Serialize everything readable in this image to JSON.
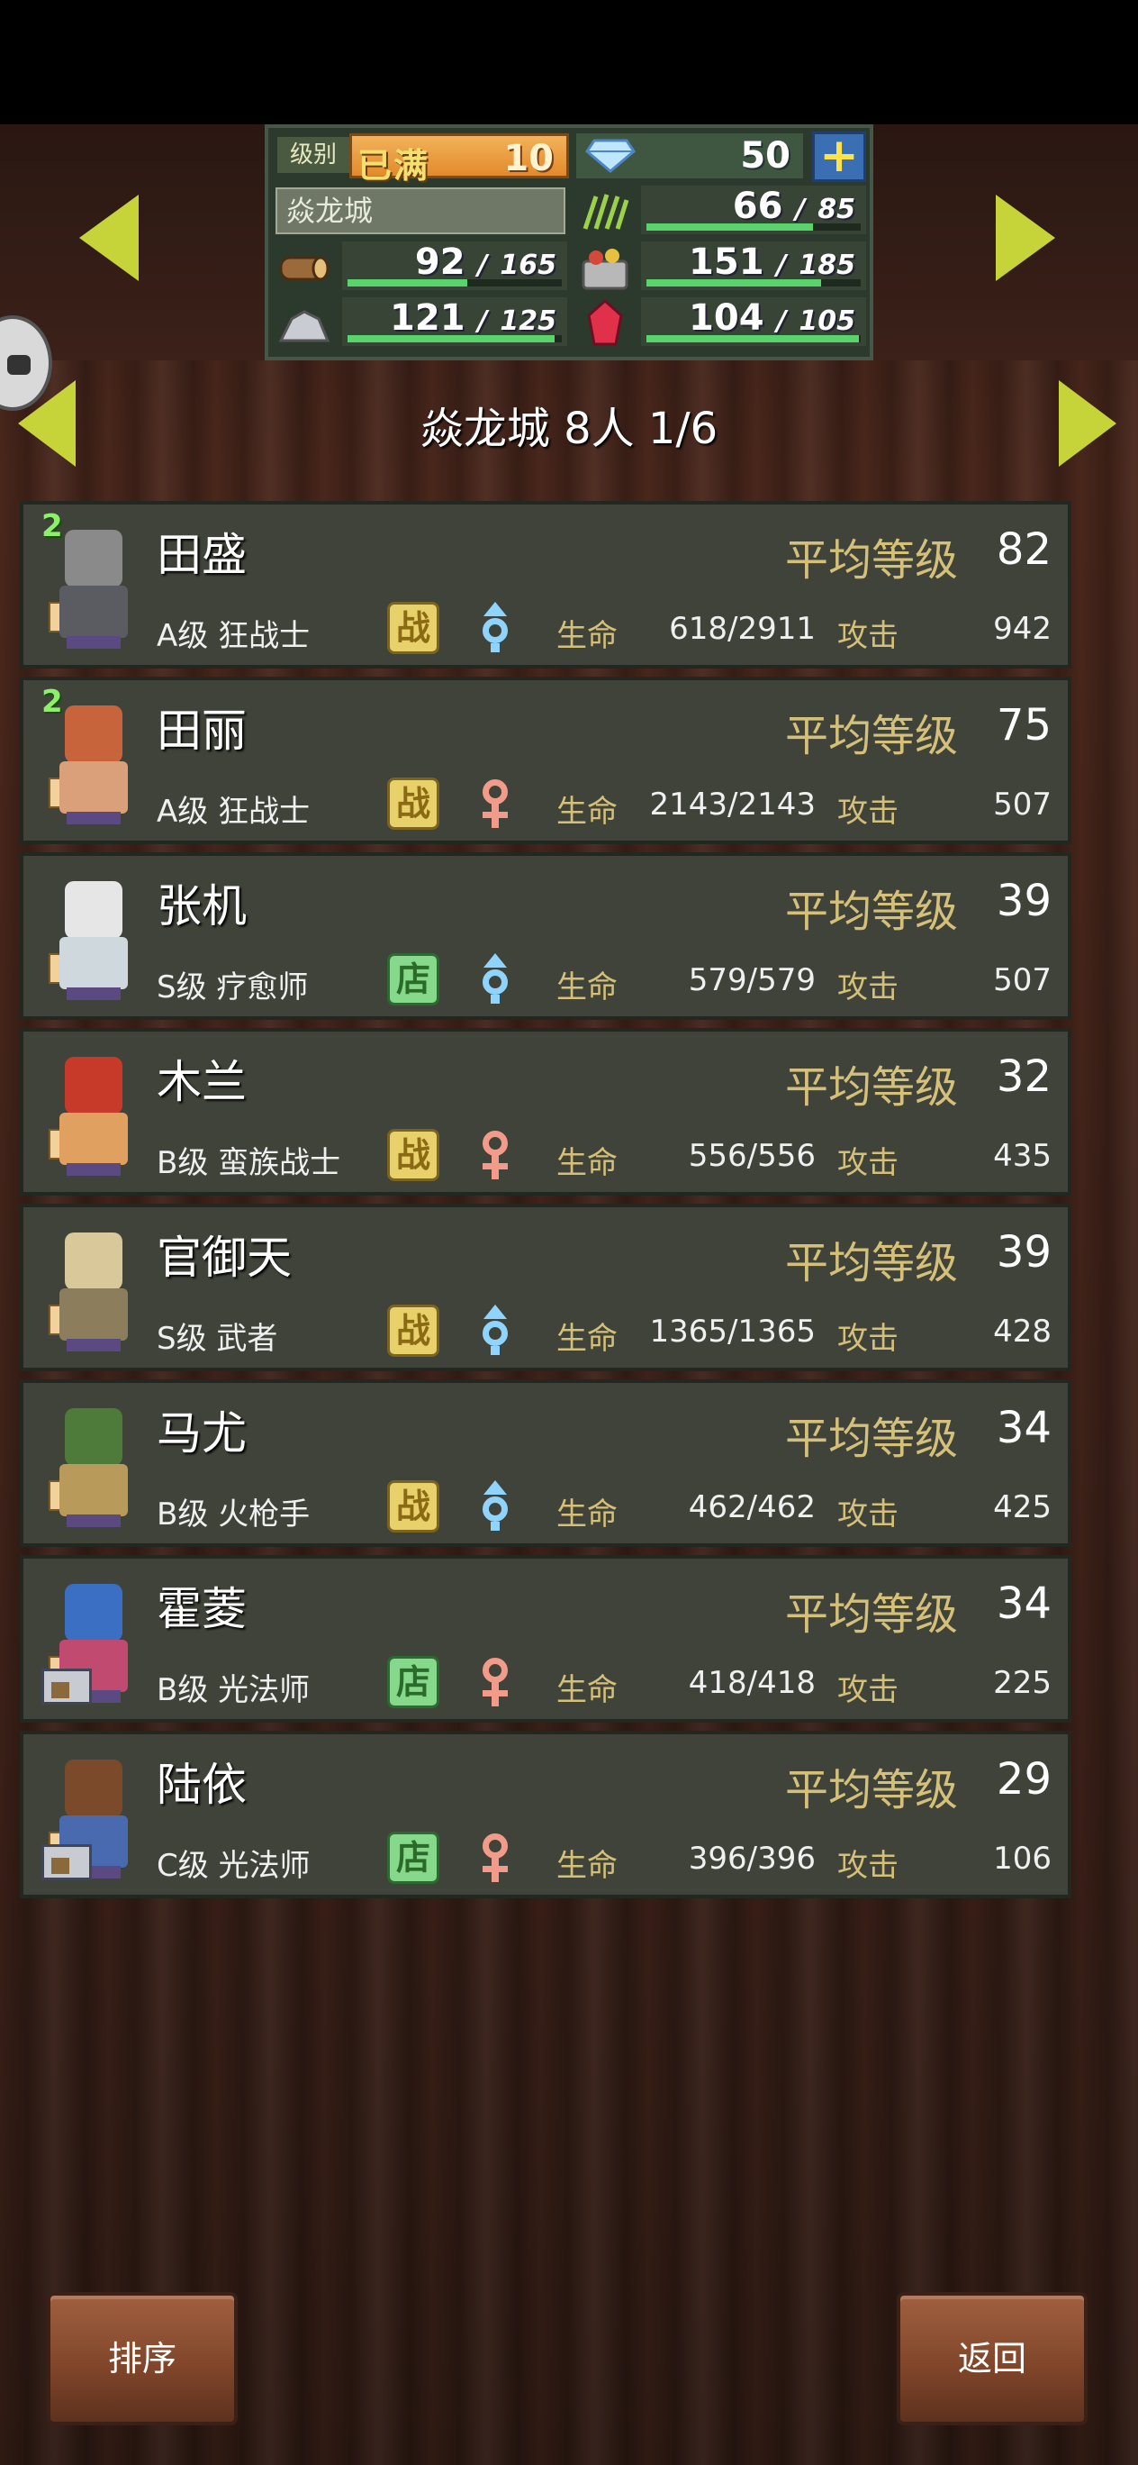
{
  "status": {
    "level_label": "级别",
    "level_max_text": "已满",
    "level_value": "10",
    "gems": "50",
    "plus": "+",
    "city_name": "焱龙城",
    "grass": {
      "cur": "66",
      "max": "85",
      "fill": 0.776
    },
    "wood": {
      "cur": "92",
      "max": "165",
      "fill": 0.558
    },
    "food": {
      "cur": "151",
      "max": "185",
      "fill": 0.816
    },
    "ore": {
      "cur": "121",
      "max": "125",
      "fill": 0.968
    },
    "crystal": {
      "cur": "104",
      "max": "105",
      "fill": 0.99
    },
    "separator": "/"
  },
  "page": {
    "title": "焱龙城  8人 1/6"
  },
  "labels": {
    "avg_level": "平均等级",
    "hp": "生命",
    "atk": "攻击"
  },
  "members": [
    {
      "name": "田盛",
      "cls": "A级 狂战士",
      "role": "战",
      "role_type": "zhan",
      "gender": "male",
      "avg": "82",
      "hp": "618/2911",
      "atk": "942",
      "badge": "2",
      "shop": false,
      "colors": {
        "head": "#8a8a8a",
        "body": "#5b5b62"
      }
    },
    {
      "name": "田丽",
      "cls": "A级 狂战士",
      "role": "战",
      "role_type": "zhan",
      "gender": "female",
      "avg": "75",
      "hp": "2143/2143",
      "atk": "507",
      "badge": "2",
      "shop": false,
      "colors": {
        "head": "#c8643c",
        "body": "#d9a07a"
      }
    },
    {
      "name": "张机",
      "cls": "S级 疗愈师",
      "role": "店",
      "role_type": "dian",
      "gender": "male",
      "avg": "39",
      "hp": "579/579",
      "atk": "507",
      "badge": "",
      "shop": false,
      "colors": {
        "head": "#e6e6e6",
        "body": "#cfd8dc"
      }
    },
    {
      "name": "木兰",
      "cls": "B级 蛮族战士",
      "role": "战",
      "role_type": "zhan",
      "gender": "female",
      "avg": "32",
      "hp": "556/556",
      "atk": "435",
      "badge": "",
      "shop": false,
      "colors": {
        "head": "#c73a2a",
        "body": "#e0a060"
      }
    },
    {
      "name": "官御天",
      "cls": "S级 武者",
      "role": "战",
      "role_type": "zhan",
      "gender": "male",
      "avg": "39",
      "hp": "1365/1365",
      "atk": "428",
      "badge": "",
      "shop": false,
      "colors": {
        "head": "#d8c89a",
        "body": "#8c7d5c"
      }
    },
    {
      "name": "马尤",
      "cls": "B级 火枪手",
      "role": "战",
      "role_type": "zhan",
      "gender": "male",
      "avg": "34",
      "hp": "462/462",
      "atk": "425",
      "badge": "",
      "shop": false,
      "colors": {
        "head": "#4e7a3a",
        "body": "#b89a5a"
      }
    },
    {
      "name": "霍菱",
      "cls": "B级 光法师",
      "role": "店",
      "role_type": "dian",
      "gender": "female",
      "avg": "34",
      "hp": "418/418",
      "atk": "225",
      "badge": "",
      "shop": true,
      "colors": {
        "head": "#3a6fc4",
        "body": "#c04a70"
      }
    },
    {
      "name": "陆依",
      "cls": "C级 光法师",
      "role": "店",
      "role_type": "dian",
      "gender": "female",
      "avg": "29",
      "hp": "396/396",
      "atk": "106",
      "badge": "",
      "shop": true,
      "colors": {
        "head": "#7a4a2a",
        "body": "#4a6ab0"
      }
    }
  ],
  "buttons": {
    "sort": "排序",
    "back": "返回"
  }
}
